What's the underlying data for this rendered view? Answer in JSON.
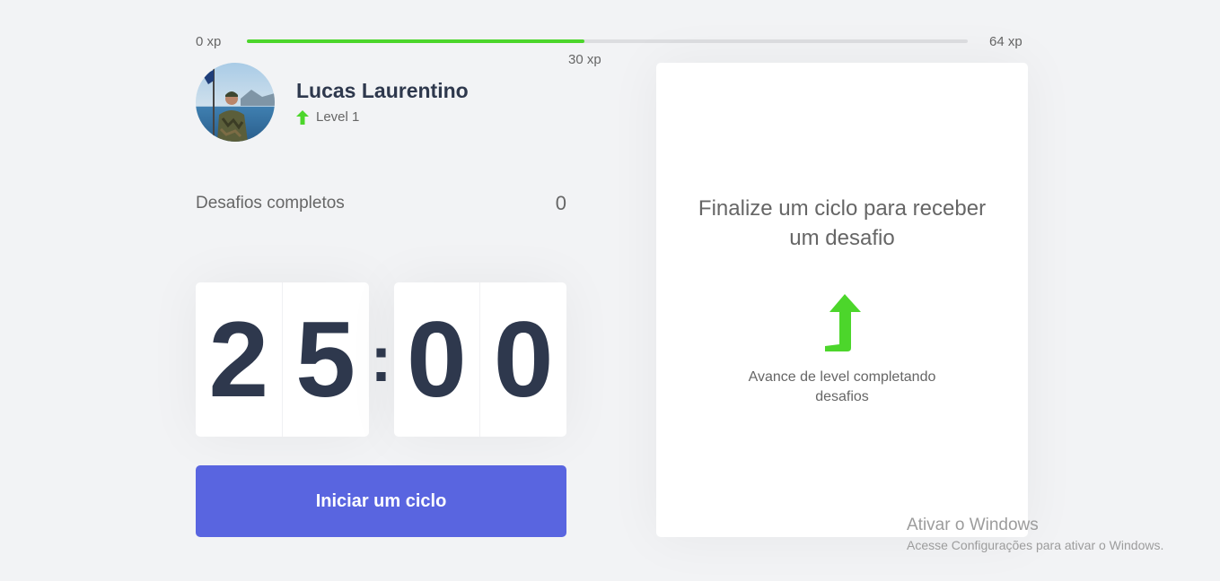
{
  "xp": {
    "min_label": "0 xp",
    "max_label": "64 xp",
    "current_label": "30 xp",
    "current": 30,
    "max": 64,
    "bar_color": "#4cd62b"
  },
  "profile": {
    "name": "Lucas Laurentino",
    "level_label": "Level 1",
    "level_icon": "level-up-arrow-icon"
  },
  "challenges": {
    "label": "Desafios completos",
    "count": "0"
  },
  "countdown": {
    "minute_left": "2",
    "minute_right": "5",
    "separator": ":",
    "second_left": "0",
    "second_right": "0"
  },
  "start_button": {
    "label": "Iniciar um ciclo",
    "color": "#5965e0"
  },
  "challenge_box": {
    "title": "Finalize um ciclo para receber um desafio",
    "hint": "Avance de level completando desafios",
    "icon": "level-up-arrow-icon"
  },
  "windows_watermark": {
    "title": "Ativar o Windows",
    "subtitle": "Acesse Configurações para ativar o Windows."
  }
}
